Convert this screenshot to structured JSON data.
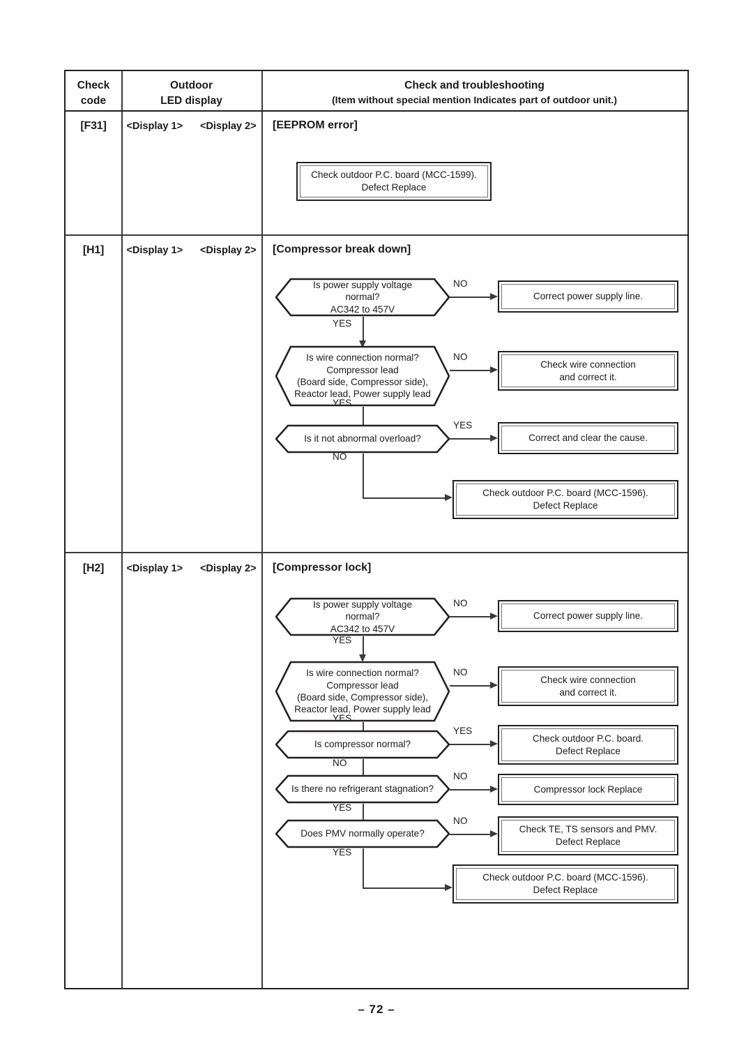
{
  "page": {
    "number": "– 72 –"
  },
  "table": {
    "header": {
      "col_code": "Check\ncode",
      "col_code_l1": "Check",
      "col_code_l2": "code",
      "col_led_l1": "Outdoor",
      "col_led_l2": "LED display",
      "col_check_l1": "Check and troubleshooting",
      "col_check_l2": "(Item without special mention Indicates part of outdoor unit.)"
    },
    "rows": [
      {
        "code": "[F31]",
        "display1": "<Display 1>",
        "display2": "<Display 2>",
        "title": "[EEPROM error]",
        "boxes": [
          {
            "line1": "Check outdoor P.C. board (MCC-1599).",
            "line2": "Defect     Replace"
          }
        ]
      },
      {
        "code": "[H1]",
        "display1": "<Display 1>",
        "display2": "<Display 2>",
        "title": "[Compressor break down]",
        "decisions": [
          {
            "line1": "Is power supply voltage normal?",
            "line2": "AC342 to 457V",
            "branch_label": "NO",
            "down_label": "YES"
          },
          {
            "line1": "Is wire connection normal?",
            "line2": "Compressor lead",
            "line3": "(Board side, Compressor side),",
            "line4": "Reactor lead, Power supply lead",
            "branch_label": "NO",
            "down_label": "YES"
          },
          {
            "line1": "Is it not abnormal overload?",
            "branch_label": "YES",
            "down_label": "NO"
          }
        ],
        "boxes": [
          {
            "line1": "Correct power supply line."
          },
          {
            "line1": "Check wire connection",
            "line2": "and correct it."
          },
          {
            "line1": "Correct and clear the cause."
          },
          {
            "line1": "Check outdoor P.C. board (MCC-1596).",
            "line2": "Defect     Replace"
          }
        ]
      },
      {
        "code": "[H2]",
        "display1": "<Display 1>",
        "display2": "<Display 2>",
        "title": "[Compressor lock]",
        "decisions": [
          {
            "line1": "Is power supply voltage normal?",
            "line2": "AC342 to 457V",
            "branch_label": "NO",
            "down_label": "YES"
          },
          {
            "line1": "Is wire connection normal?",
            "line2": "Compressor lead",
            "line3": "(Board side, Compressor side),",
            "line4": "Reactor lead, Power supply lead",
            "branch_label": "NO",
            "down_label": "YES"
          },
          {
            "line1": "Is compressor normal?",
            "branch_label": "YES",
            "down_label": "NO"
          },
          {
            "line1": "Is there no refrigerant stagnation?",
            "branch_label": "NO",
            "down_label": "YES"
          },
          {
            "line1": "Does PMV normally operate?",
            "branch_label": "NO",
            "down_label": "YES"
          }
        ],
        "boxes": [
          {
            "line1": "Correct power supply line."
          },
          {
            "line1": "Check wire connection",
            "line2": "and correct it."
          },
          {
            "line1": "Check outdoor P.C. board.",
            "line2": "Defect     Replace"
          },
          {
            "line1": "Compressor lock     Replace"
          },
          {
            "line1": "Check TE, TS sensors and PMV.",
            "line2": "Defect     Replace"
          },
          {
            "line1": "Check outdoor P.C. board (MCC-1596).",
            "line2": "Defect     Replace"
          }
        ]
      }
    ]
  }
}
